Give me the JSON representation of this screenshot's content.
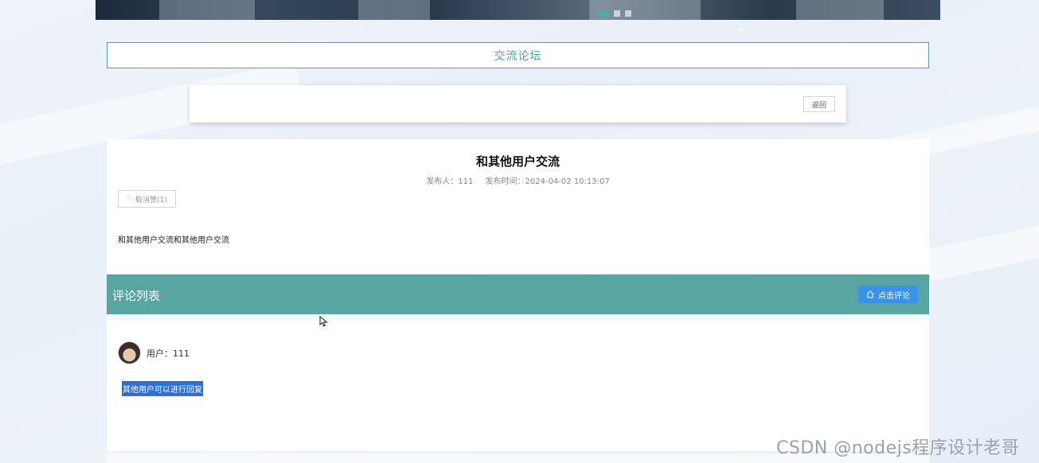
{
  "header": {
    "section_title": "交流论坛",
    "carousel_slide_count": 3,
    "carousel_active_index": 0
  },
  "toolbar": {
    "back_label": "返回"
  },
  "post": {
    "title": "和其他用户交流",
    "author_label": "发布人：111",
    "time_label": "发布时间：2024-04-02 10:13:07",
    "like_label": "取消赞(1)",
    "body": "和其他用户交流和其他用户交流"
  },
  "comments": {
    "header_title": "评论列表",
    "comment_button_label": "点击评论",
    "items": [
      {
        "user_label": "用户：111",
        "text": "其他用户可以进行回复"
      }
    ]
  },
  "watermark": "CSDN @nodejs程序设计老哥",
  "colors": {
    "accent": "#58a5a1",
    "button_blue": "#3a93e9",
    "selection_blue": "#2d6fd6"
  }
}
